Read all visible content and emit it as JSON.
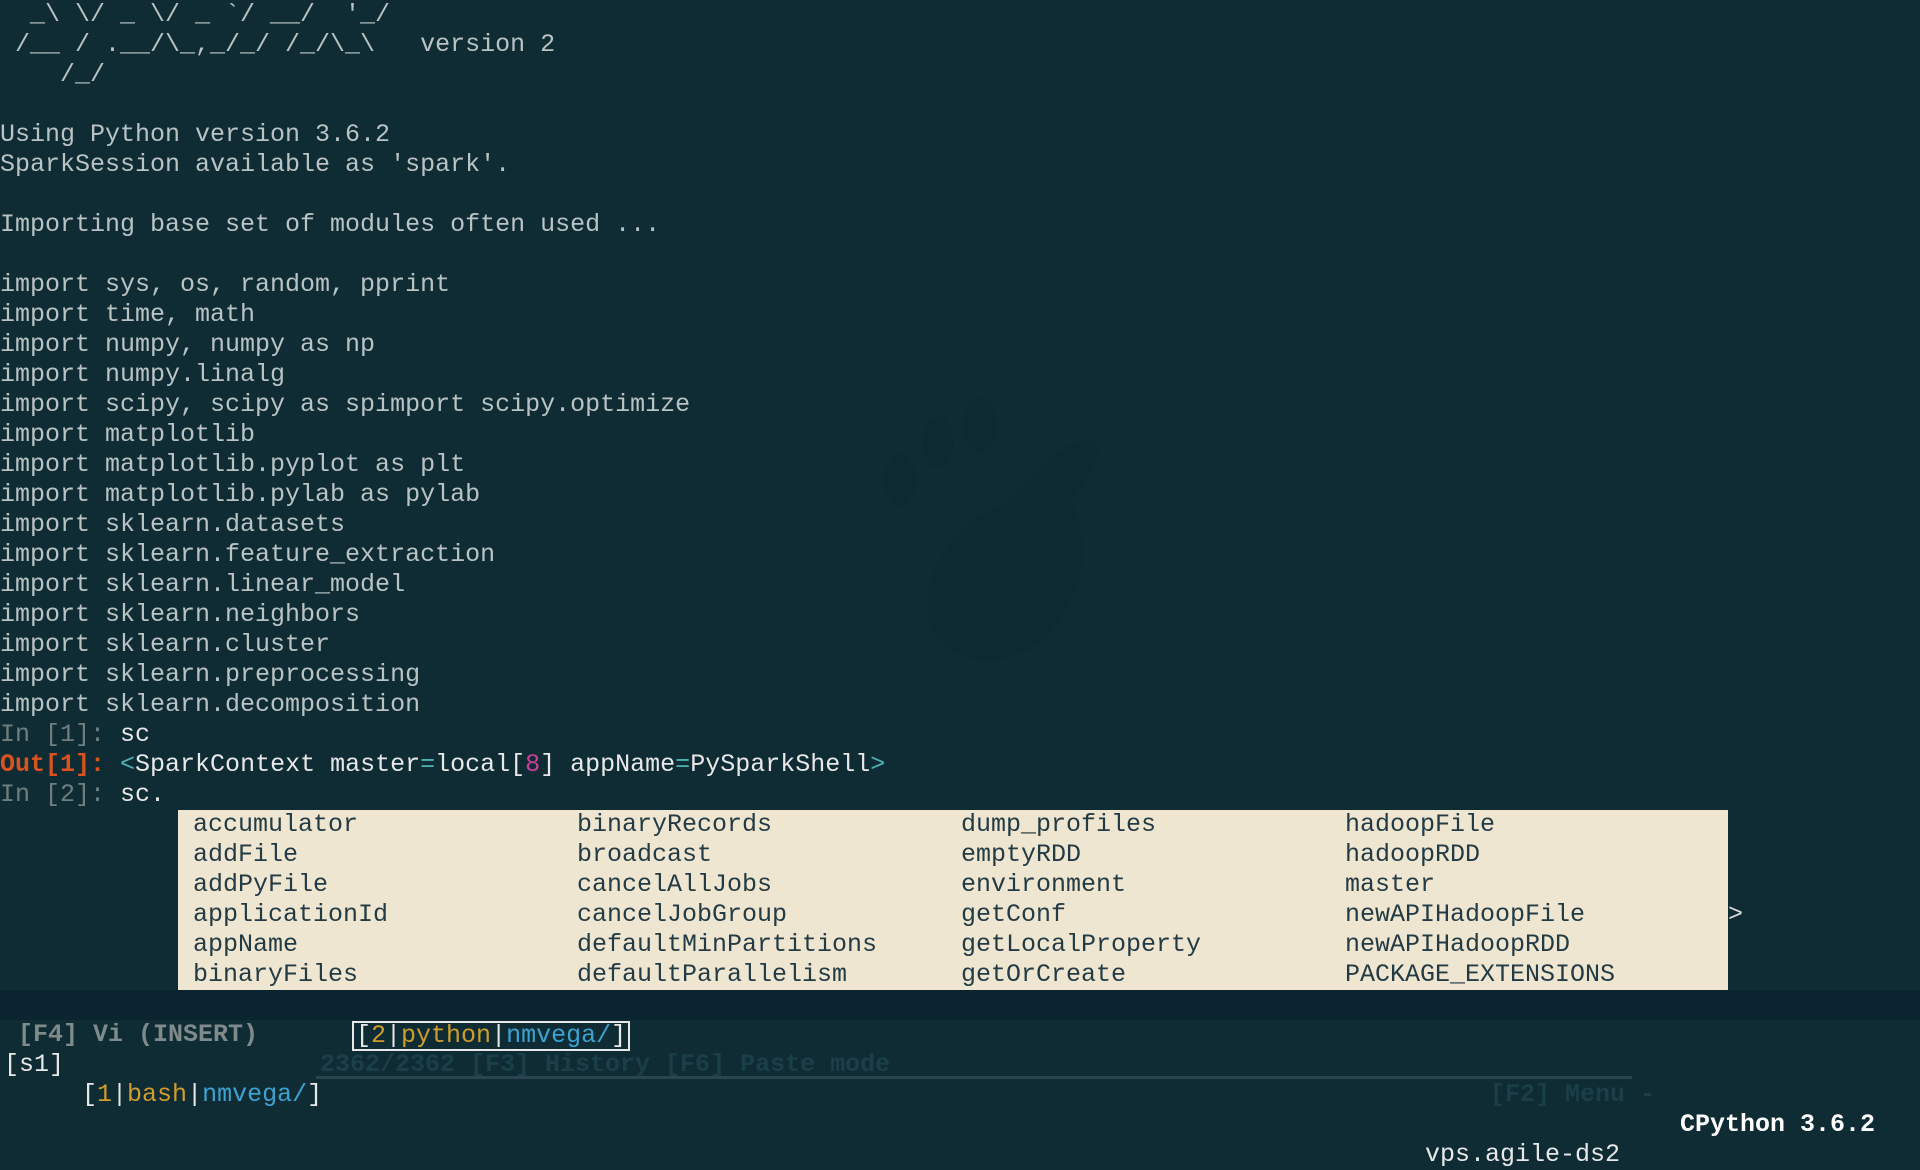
{
  "banner": {
    "art_line1": "  _\\ \\/ _ \\/ _ `/ __/  '_/",
    "art_line2": " /__ / .__/\\_,_/_/ /_/\\_\\",
    "art_version": "version 2",
    "art_line3": "    /_/"
  },
  "startup": {
    "python_version": "Using Python version 3.6.2",
    "session": "SparkSession available as 'spark'.",
    "importing": "Importing base set of modules often used ...",
    "imports": [
      "import sys, os, random, pprint",
      "import time, math",
      "import numpy, numpy as np",
      "import numpy.linalg",
      "import scipy, scipy as spimport scipy.optimize",
      "import matplotlib",
      "import matplotlib.pyplot as plt",
      "import matplotlib.pylab as pylab",
      "import sklearn.datasets",
      "import sklearn.feature_extraction",
      "import sklearn.linear_model",
      "import sklearn.neighbors",
      "import sklearn.cluster",
      "import sklearn.preprocessing",
      "import sklearn.decomposition"
    ]
  },
  "session_io": {
    "in1_prompt": "In [1]: ",
    "in1_code": "sc",
    "out1_prompt": "Out[1]: ",
    "out1_lt": "<",
    "out1_a": "SparkContext master",
    "out1_eq1": "=",
    "out1_b": "local[",
    "out1_num": "8",
    "out1_c": "] appName",
    "out1_eq2": "=",
    "out1_d": "PySparkShell",
    "out1_gt": ">",
    "in2_prompt": "In [2]: ",
    "in2_code": "sc."
  },
  "completions": {
    "col1": [
      "accumulator",
      "addFile",
      "addPyFile",
      "applicationId",
      "appName",
      "binaryFiles"
    ],
    "col2": [
      "binaryRecords",
      "broadcast",
      "cancelAllJobs",
      "cancelJobGroup",
      "defaultMinPartitions",
      "defaultParallelism"
    ],
    "col3": [
      "dump_profiles",
      "emptyRDD",
      "environment",
      "getConf",
      "getLocalProperty",
      "getOrCreate"
    ],
    "col4": [
      "hadoopFile",
      "hadoopRDD",
      "master",
      "newAPIHadoopFile",
      "newAPIHadoopRDD",
      "PACKAGE_EXTENSIONS"
    ],
    "more_indicator": ">"
  },
  "status_bar": {
    "vi_mode": "[F4] Vi (INSERT)",
    "history": "2362/2362 [F3] History [F6] Paste mode",
    "menu": "[F2] Menu -",
    "python": "CPython 3.6.2"
  },
  "tmux": {
    "session": "[s1]",
    "win1_open": "[",
    "win1_num": "1",
    "win1_sep1": "|",
    "win1_cmd": "bash",
    "win1_sep2": "|",
    "win1_path": "nmvega/",
    "win1_close": "]",
    "win2_open": "[",
    "win2_num": "2",
    "win2_sep1": "|",
    "win2_cmd": "python",
    "win2_sep2": "|",
    "win2_path": "nmvega/",
    "win2_close": "]",
    "host": "vps.agile-ds2"
  },
  "colors": {
    "background": "#0f2c35",
    "popup": "#efe6d2",
    "out_prompt": "#d9531e",
    "accent_yellow": "#cf9d2c",
    "accent_blue": "#3ea2d0"
  }
}
